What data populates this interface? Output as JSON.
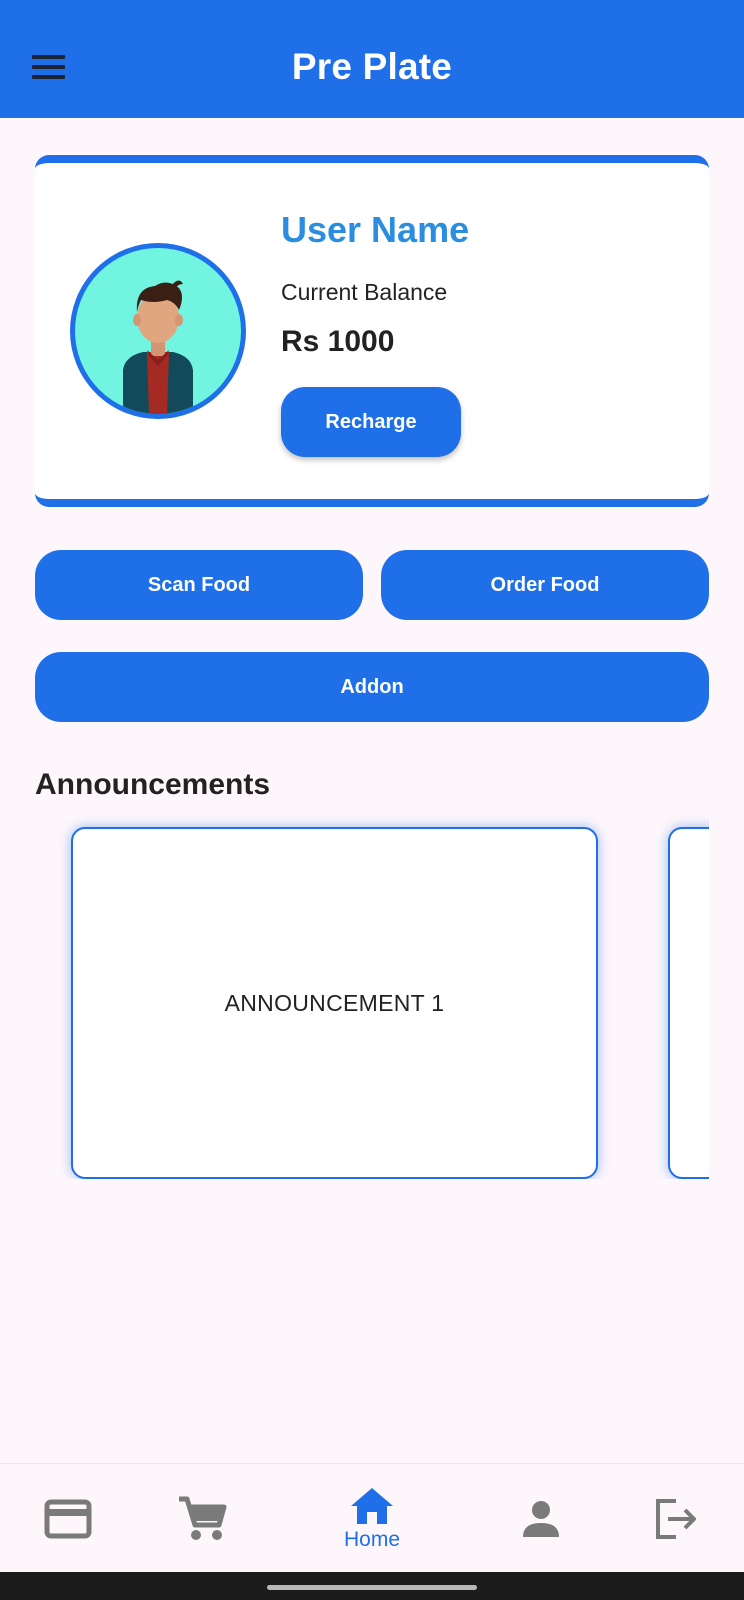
{
  "app_bar": {
    "title": "Pre Plate",
    "menu_icon": "hamburger-menu-icon"
  },
  "profile": {
    "user_name": "User Name",
    "balance_label": "Current Balance",
    "balance_value": "Rs 1000",
    "recharge_label": "Recharge",
    "avatar": "user-avatar-illustration"
  },
  "actions": {
    "scan_food": "Scan Food",
    "order_food": "Order Food",
    "addon": "Addon"
  },
  "announcements": {
    "title": "Announcements",
    "items": [
      "ANNOUNCEMENT 1",
      ""
    ]
  },
  "bottom_nav": {
    "items": [
      {
        "icon": "credit-card-icon",
        "label": ""
      },
      {
        "icon": "cart-icon",
        "label": ""
      },
      {
        "icon": "home-icon",
        "label": "Home",
        "active": true
      },
      {
        "icon": "person-icon",
        "label": ""
      },
      {
        "icon": "logout-icon",
        "label": ""
      }
    ]
  },
  "colors": {
    "primary": "#1f6fe8",
    "accent_text": "#2b8de0",
    "background": "#fdf7fb",
    "icon_inactive": "#7a7a7a"
  }
}
